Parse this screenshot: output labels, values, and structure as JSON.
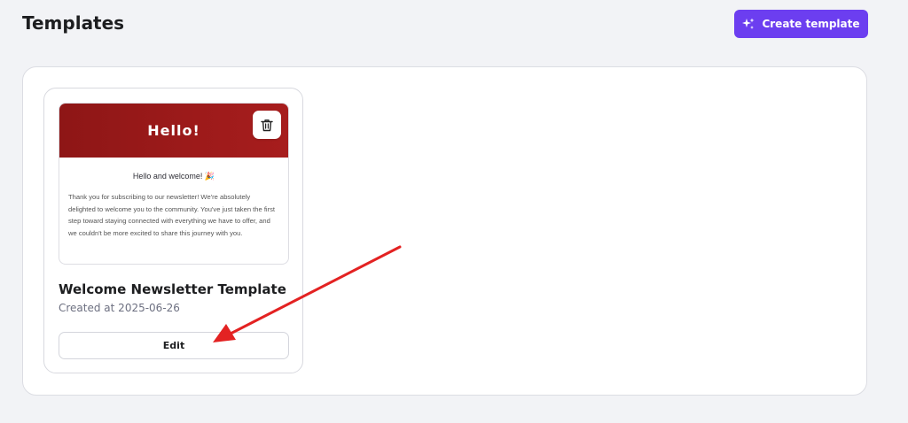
{
  "header": {
    "title": "Templates",
    "create_button_label": "Create template"
  },
  "templates": [
    {
      "preview": {
        "header_text": "Hello!",
        "greeting": "Hello and welcome! 🎉",
        "body": "Thank you for subscribing to our newsletter! We're absolutely delighted to welcome you to the community. You've just taken the first step toward staying connected with everything we have to offer, and we couldn't be more excited to share this journey with you."
      },
      "name": "Welcome Newsletter Template",
      "created": "Created at 2025-06-26",
      "edit_label": "Edit"
    }
  ],
  "colors": {
    "accent": "#6c3ef0",
    "preview_header": "#a01b1b",
    "annotation_arrow": "#e32222"
  },
  "icons": {
    "create": "sparkle-icon",
    "delete": "trash-icon"
  }
}
